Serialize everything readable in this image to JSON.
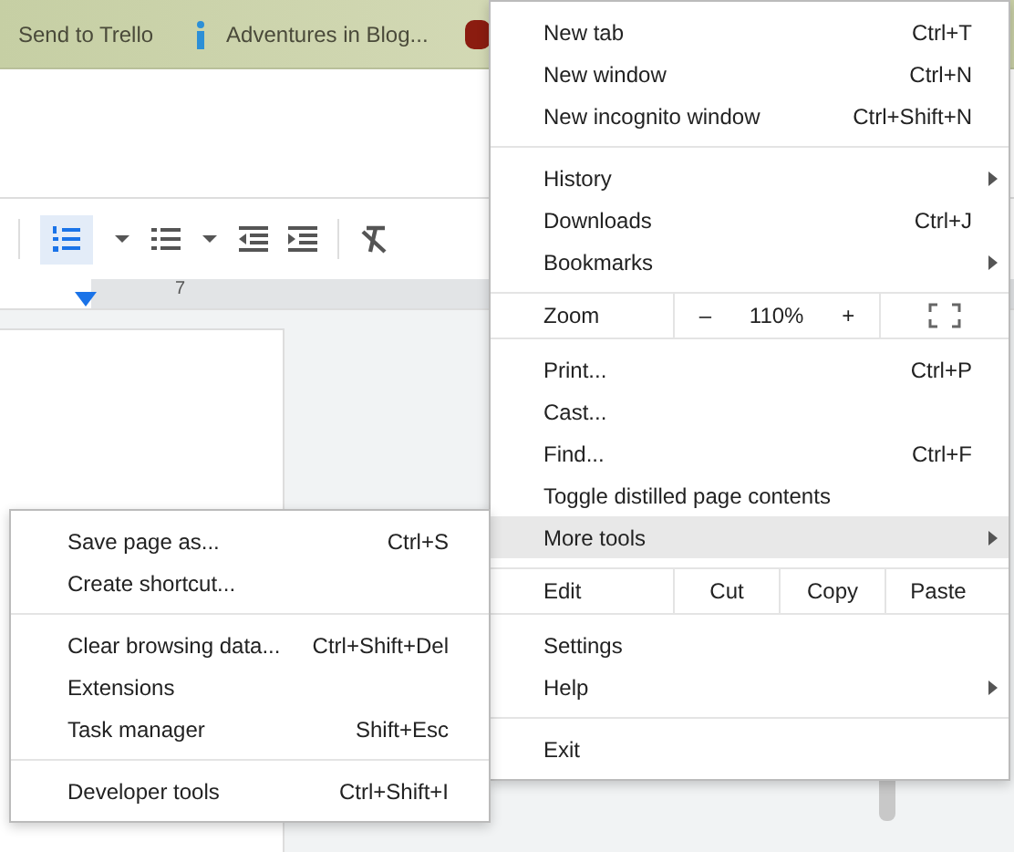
{
  "bookmarks": [
    {
      "label": "Send to Trello"
    },
    {
      "label": "Adventures in Blog..."
    }
  ],
  "ruler": {
    "mark": "7"
  },
  "menu": {
    "sections": [
      {
        "items": [
          {
            "kind": "item",
            "label": "New tab",
            "shortcut": "Ctrl+T",
            "submenu": false,
            "selected": false
          },
          {
            "kind": "item",
            "label": "New window",
            "shortcut": "Ctrl+N",
            "submenu": false,
            "selected": false
          },
          {
            "kind": "item",
            "label": "New incognito window",
            "shortcut": "Ctrl+Shift+N",
            "submenu": false,
            "selected": false
          }
        ]
      },
      {
        "items": [
          {
            "kind": "item",
            "label": "History",
            "submenu": true,
            "selected": false
          },
          {
            "kind": "item",
            "label": "Downloads",
            "shortcut": "Ctrl+J",
            "submenu": false,
            "selected": false
          },
          {
            "kind": "item",
            "label": "Bookmarks",
            "submenu": true,
            "selected": false
          }
        ]
      },
      {
        "items": [
          {
            "kind": "zoom",
            "label": "Zoom",
            "minus": "–",
            "value": "110%",
            "plus": "+"
          }
        ]
      },
      {
        "items": [
          {
            "kind": "item",
            "label": "Print...",
            "shortcut": "Ctrl+P",
            "submenu": false,
            "selected": false
          },
          {
            "kind": "item",
            "label": "Cast...",
            "submenu": false,
            "selected": false
          },
          {
            "kind": "item",
            "label": "Find...",
            "shortcut": "Ctrl+F",
            "submenu": false,
            "selected": false
          },
          {
            "kind": "item",
            "label": "Toggle distilled page contents",
            "submenu": false,
            "selected": false
          },
          {
            "kind": "item",
            "label": "More tools",
            "submenu": true,
            "selected": true
          }
        ]
      },
      {
        "items": [
          {
            "kind": "edit",
            "label": "Edit",
            "buttons": [
              "Cut",
              "Copy",
              "Paste"
            ]
          }
        ]
      },
      {
        "items": [
          {
            "kind": "item",
            "label": "Settings",
            "submenu": false,
            "selected": false
          },
          {
            "kind": "item",
            "label": "Help",
            "submenu": true,
            "selected": false
          }
        ]
      },
      {
        "items": [
          {
            "kind": "item",
            "label": "Exit",
            "submenu": false,
            "selected": false
          }
        ]
      }
    ]
  },
  "submenu": {
    "sections": [
      {
        "items": [
          {
            "label": "Save page as...",
            "shortcut": "Ctrl+S"
          },
          {
            "label": "Create shortcut..."
          }
        ]
      },
      {
        "items": [
          {
            "label": "Clear browsing data...",
            "shortcut": "Ctrl+Shift+Del"
          },
          {
            "label": "Extensions"
          },
          {
            "label": "Task manager",
            "shortcut": "Shift+Esc"
          }
        ]
      },
      {
        "items": [
          {
            "label": "Developer tools",
            "shortcut": "Ctrl+Shift+I"
          }
        ]
      }
    ]
  }
}
